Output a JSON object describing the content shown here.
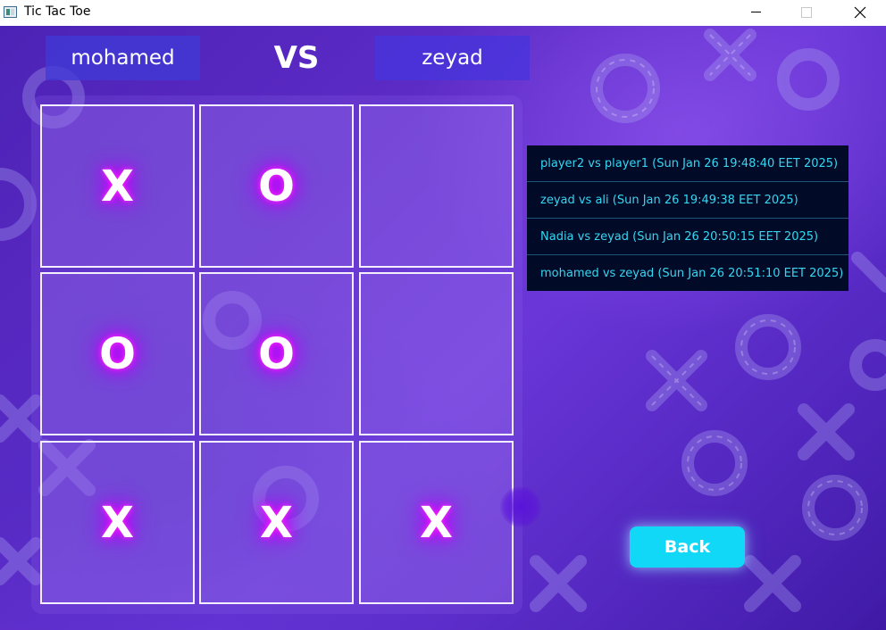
{
  "window": {
    "title": "Tic Tac Toe"
  },
  "header": {
    "player1": "mohamed",
    "vs": "VS",
    "player2": "zeyad"
  },
  "board": {
    "cells": [
      "X",
      "O",
      "",
      "O",
      "O",
      "",
      "X",
      "X",
      "X"
    ]
  },
  "history": {
    "items": [
      "player2 vs player1 (Sun Jan 26 19:48:40 EET 2025)",
      "zeyad vs ali (Sun Jan 26 19:49:38 EET 2025)",
      "Nadia vs zeyad (Sun Jan 26 20:50:15 EET 2025)",
      "mohamed vs zeyad (Sun Jan 26 20:51:10 EET 2025)"
    ]
  },
  "back_button": {
    "label": "Back"
  },
  "colors": {
    "background": "#5a2cc6",
    "history_bg": "#010a26",
    "history_text": "#35d7f2",
    "back_button": "#11d8f6",
    "mark_glow": "#e000ff"
  },
  "icons": {
    "window_minimize": "minimize-icon",
    "window_maximize": "maximize-icon",
    "window_close": "close-icon"
  }
}
